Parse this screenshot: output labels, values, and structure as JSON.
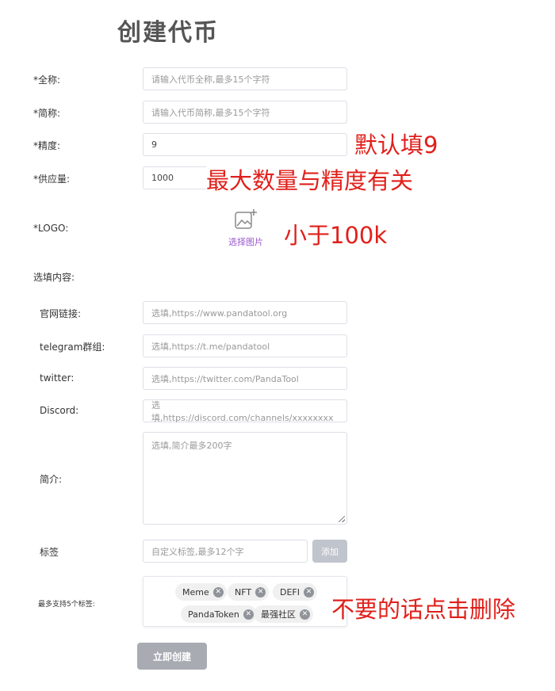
{
  "page": {
    "title": "创建代币"
  },
  "form": {
    "fullname": {
      "label": "*全称:",
      "placeholder": "请输入代币全称,最多15个字符"
    },
    "shortname": {
      "label": "*简称:",
      "placeholder": "请输入代币简称,最多15个字符"
    },
    "precision": {
      "label": "*精度:",
      "value": "9"
    },
    "supply": {
      "label": "*供应量:",
      "value": "1000"
    },
    "logo": {
      "label": "*LOGO:",
      "upload_text": "选择图片"
    },
    "optional": {
      "label": "选填内容:"
    },
    "website": {
      "label": "官网链接:",
      "placeholder": "选填,https://www.pandatool.org"
    },
    "telegram": {
      "label": "telegram群组:",
      "placeholder": "选填,https://t.me/pandatool"
    },
    "twitter": {
      "label": "twitter:",
      "placeholder": "选填,https://twitter.com/PandaTool"
    },
    "discord": {
      "label": "Discord:",
      "placeholder": "选填,https://discord.com/channels/xxxxxxxx"
    },
    "intro": {
      "label": "简介:",
      "placeholder": "选填,简介最多200字"
    },
    "tag_input": {
      "label": "标签",
      "placeholder": "自定义标签,最多12个字",
      "add_label": "添加"
    },
    "tags": {
      "label": "最多支持5个标签:",
      "items": [
        "Meme",
        "NFT",
        "DEFI",
        "PandaToken",
        "最强社区"
      ]
    },
    "submit_label": "立即创建"
  },
  "annotations": {
    "precision_note": "默认填9",
    "supply_note": "最大数量与精度有关",
    "logo_note": "小于100k",
    "tags_note": "不要的话点击删除"
  },
  "colors": {
    "annotation": "#e0201b",
    "upload_accent": "#9b59d0",
    "button_disabled": "#c0c4cc"
  }
}
